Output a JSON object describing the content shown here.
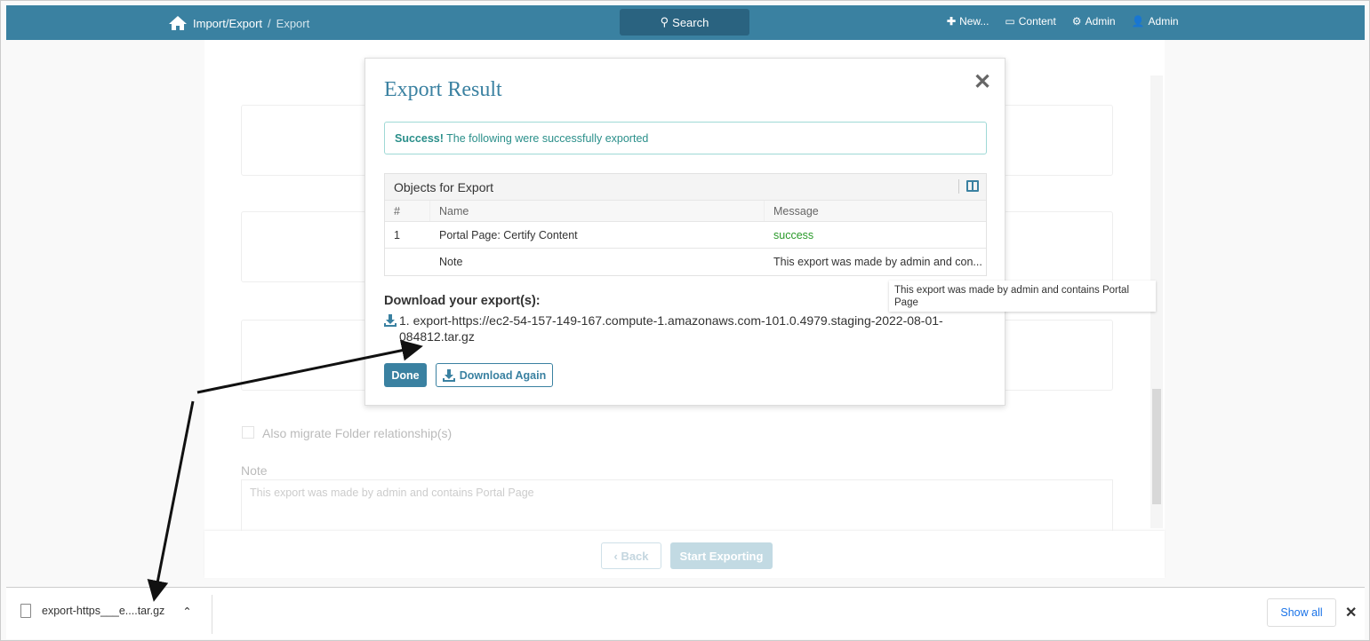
{
  "topbar": {
    "breadcrumb_parent": "Import/Export",
    "breadcrumb_sep": "/",
    "breadcrumb_current": "Export",
    "search_label": "Search",
    "new_label": "New...",
    "content_label": "Content",
    "admin_settings_label": "Admin",
    "user_label": "Admin",
    "color": "#3a81a1"
  },
  "background_form": {
    "checkbox_label": "Also migrate Folder relationship(s)",
    "note_label": "Note",
    "note_value": "This export was made by admin and contains Portal Page",
    "back_label": "Back",
    "start_label": "Start Exporting"
  },
  "modal": {
    "title": "Export Result",
    "close": "✕",
    "alert_strong": "Success!",
    "alert_text": "The following were successfully exported",
    "table": {
      "title": "Objects for Export",
      "headers": [
        "#",
        "Name",
        "Message"
      ],
      "rows": [
        {
          "num": "1",
          "name": "Portal Page: Certify Content",
          "message": "success"
        },
        {
          "num": "",
          "name": "Note",
          "message": "This export was made by admin and con..."
        }
      ]
    },
    "download_title": "Download your export(s):",
    "download_link": "1. export-https://ec2-54-157-149-167.compute-1.amazonaws.com-101.0.4979.staging-2022-08-01-084812.tar.gz",
    "done_label": "Done",
    "download_again_label": "Download Again"
  },
  "tooltip": "This export was made by admin and contains Portal Page",
  "download_bar": {
    "file_name": "export-https___e....tar.gz",
    "show_all": "Show all",
    "close": "✕"
  }
}
